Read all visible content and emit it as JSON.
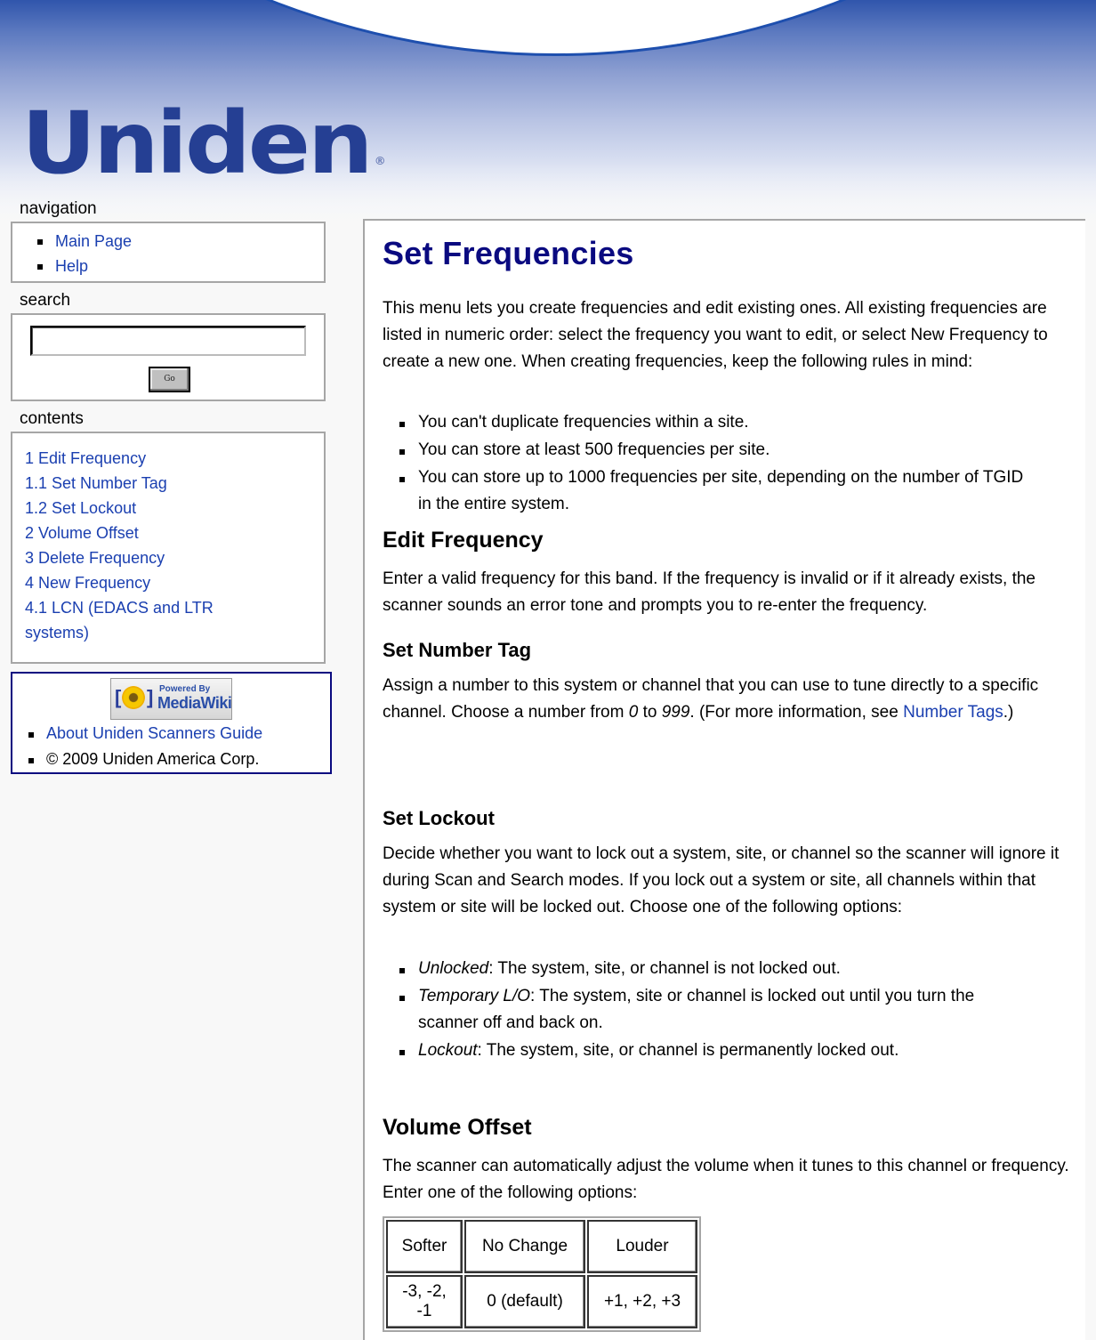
{
  "header": {
    "logo_text": "Uniden",
    "logo_mark": "®"
  },
  "sidebar": {
    "navigation": {
      "title": "navigation",
      "items": [
        {
          "label": "Main Page"
        },
        {
          "label": "Help"
        }
      ]
    },
    "search": {
      "title": "search",
      "input_value": "",
      "go_label": "Go"
    },
    "contents": {
      "title": "contents",
      "items": [
        {
          "label": "1 Edit Frequency"
        },
        {
          "label": "1.1 Set Number Tag"
        },
        {
          "label": "1.2 Set Lockout"
        },
        {
          "label": "2 Volume Offset"
        },
        {
          "label": "3 Delete Frequency"
        },
        {
          "label": "4 New Frequency"
        },
        {
          "label": "4.1 LCN (EDACS and LTR"
        },
        {
          "label": "systems)"
        }
      ]
    },
    "footer": {
      "badge_line1": "Powered By",
      "badge_line2": "MediaWiki",
      "items": [
        {
          "label": "About Uniden Scanners Guide"
        },
        {
          "label": "© 2009 Uniden America Corp."
        }
      ]
    }
  },
  "content": {
    "title": "Set Frequencies",
    "intro": "This menu lets you create frequencies and edit existing ones. All existing frequencies are listed in numeric order: select the frequency you want to edit, or select New Frequency to create a new one. When creating frequencies, keep the following rules in mind:",
    "rules": [
      "You can't duplicate frequencies within a site.",
      "You can store at least 500 frequencies per site.",
      "You can store up to 1000 frequencies per site, depending on the number of TGID in the entire system."
    ],
    "edit_frequency": {
      "heading": "Edit Frequency",
      "text": "Enter a valid frequency for this band. If the frequency is invalid or if it already exists, the scanner sounds an error tone and prompts you to re-enter the frequency."
    },
    "set_number_tag": {
      "heading": "Set Number Tag",
      "text_before": "Assign a number to this system or channel that you can use to tune directly to a specific channel. Choose a number from ",
      "num_from": "0",
      "text_mid": " to ",
      "num_to": "999",
      "text_after": ". (For more information, see ",
      "link": "Number Tags",
      "text_end": ".)"
    },
    "set_lockout": {
      "heading": "Set Lockout",
      "text": "Decide whether you want to lock out a system, site, or channel so the scanner will ignore it during Scan and Search modes. If you lock out a system or site, all channels within that system or site will be locked out. Choose one of the following options:",
      "options": [
        {
          "term": "Unlocked",
          "desc": ": The system, site, or channel is not locked out."
        },
        {
          "term": "Temporary L/O",
          "desc": ": The system, site or channel is locked out until you turn the scanner off and back on."
        },
        {
          "term": "Lockout",
          "desc": ": The system, site, or channel is permanently locked out."
        }
      ]
    },
    "volume_offset": {
      "heading": "Volume Offset",
      "text": "The scanner can automatically adjust the volume when it tunes to this channel or frequency. Enter one of the following options:",
      "table": {
        "headers": [
          "Softer",
          "No Change",
          "Louder"
        ],
        "values": [
          "-3, -2, -1",
          "0 (default)",
          "+1, +2, +3"
        ]
      }
    }
  }
}
